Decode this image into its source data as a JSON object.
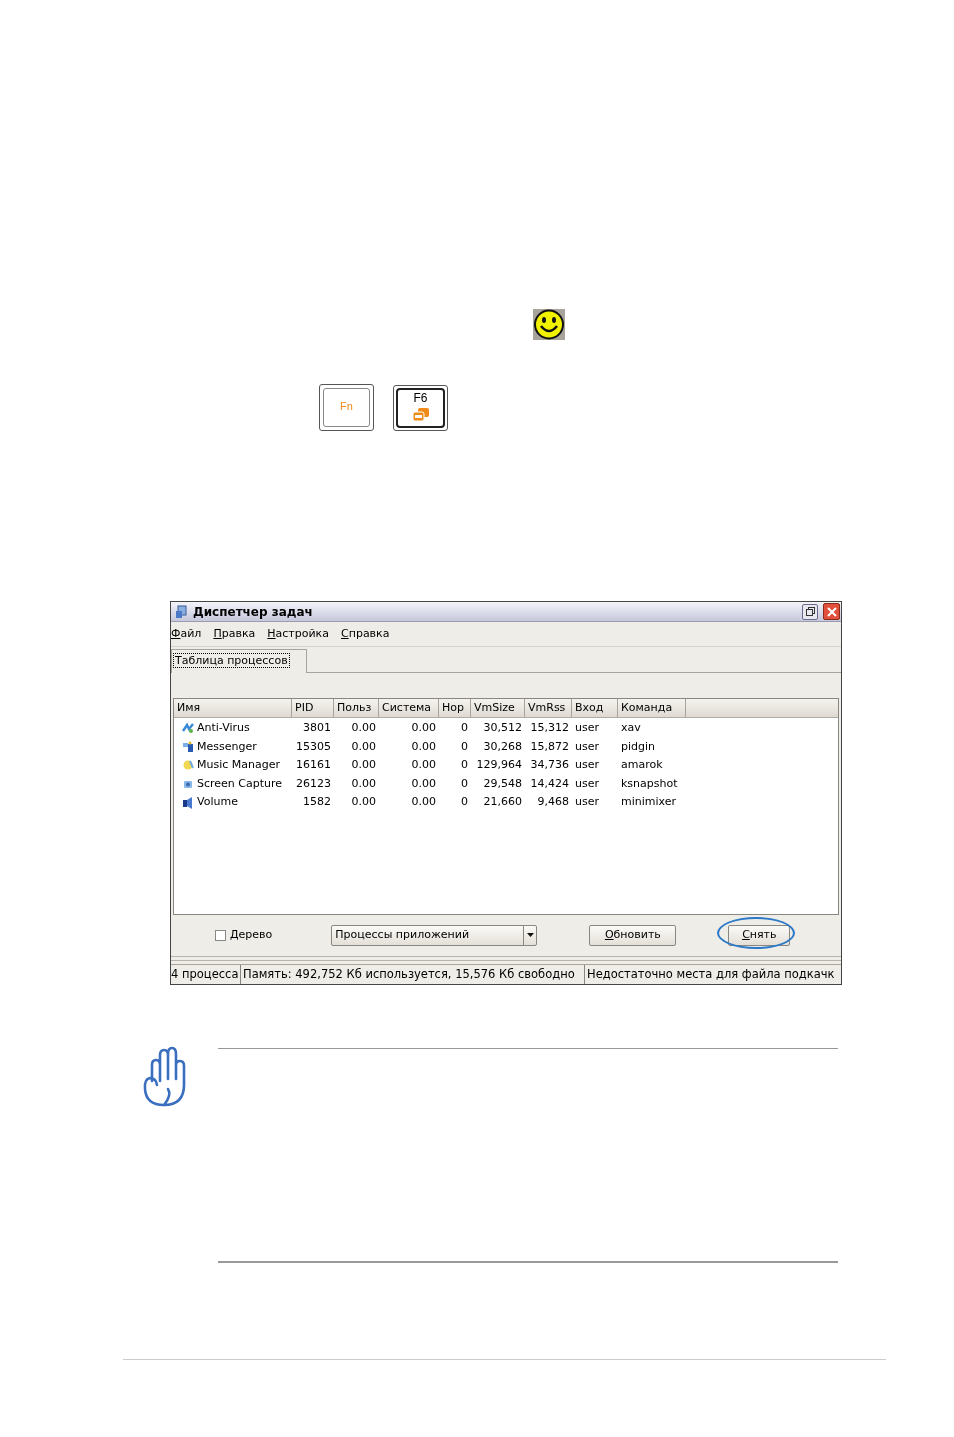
{
  "keys": [
    {
      "kind": "modifier",
      "label": "Fn"
    },
    {
      "kind": "function",
      "label": "F6"
    }
  ],
  "window": {
    "title": "Диспетчер задач",
    "menu": [
      "Файл",
      "Правка",
      "Настройка",
      "Справка"
    ],
    "tabs": [
      {
        "label": "Таблица процессов",
        "selected": true
      }
    ],
    "table": {
      "columns": [
        {
          "label": "Имя"
        },
        {
          "label": "PID"
        },
        {
          "label": "Польз"
        },
        {
          "label": "Система"
        },
        {
          "label": "Нор"
        },
        {
          "label": "VmSize"
        },
        {
          "label": "VmRss"
        },
        {
          "label": "Вход"
        },
        {
          "label": "Команда"
        }
      ],
      "rows": [
        {
          "cells": [
            "Anti-Virus",
            "3801",
            "0.00",
            "0.00",
            "0",
            "30,512",
            "15,312",
            "user",
            "xav"
          ]
        },
        {
          "cells": [
            "Messenger",
            "15305",
            "0.00",
            "0.00",
            "0",
            "30,268",
            "15,872",
            "user",
            "pidgin"
          ]
        },
        {
          "cells": [
            "Music Manager",
            "16161",
            "0.00",
            "0.00",
            "0",
            "129,964",
            "34,736",
            "user",
            "amarok"
          ]
        },
        {
          "cells": [
            "Screen Capture",
            "26123",
            "0.00",
            "0.00",
            "0",
            "29,548",
            "14,424",
            "user",
            "ksnapshot"
          ]
        },
        {
          "cells": [
            "Volume",
            "1582",
            "0.00",
            "0.00",
            "0",
            "21,660",
            "9,468",
            "user",
            "minimixer"
          ]
        }
      ]
    },
    "tree_checkbox": {
      "label": "Дерево",
      "checked": false
    },
    "filter_dropdown": {
      "value": "Процессы приложений"
    },
    "buttons": [
      {
        "label": "Обновить",
        "highlighted": false
      },
      {
        "label": "Снять",
        "highlighted": true
      }
    ],
    "status_bar": [
      "4 процесса",
      "Память: 492,752 Кб используется, 15,576 Кб свободно",
      "Недостаточно места для файла подкачк"
    ]
  }
}
